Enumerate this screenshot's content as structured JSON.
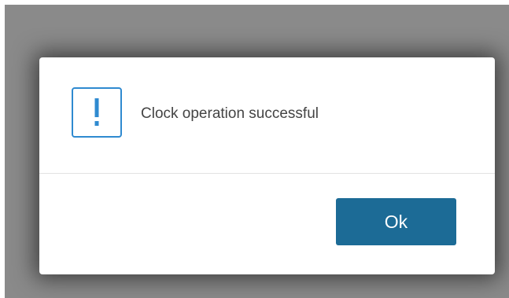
{
  "dialog": {
    "icon": "exclamation-icon",
    "message": "Clock operation successful",
    "ok_label": "Ok"
  },
  "colors": {
    "backdrop": "#8a8a8a",
    "accent": "#2f8ad0",
    "button": "#1c6b96"
  }
}
